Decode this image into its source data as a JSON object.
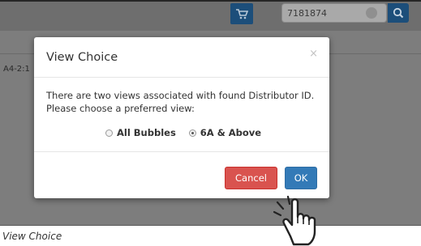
{
  "search": {
    "value": "7181874"
  },
  "side_label": "A4-2:1",
  "modal": {
    "title": "View Choice",
    "close_label": "×",
    "message_line1": "There are two views associated with found Distributor ID.",
    "message_line2": "Please choose a preferred view:",
    "options": [
      {
        "label": "All Bubbles",
        "selected": false
      },
      {
        "label": "6A & Above",
        "selected": true
      }
    ],
    "cancel_label": "Cancel",
    "ok_label": "OK"
  },
  "caption": "View Choice",
  "colors": {
    "primary": "#337ab7",
    "danger": "#d9534f",
    "overlay": "#7d7d7d"
  },
  "icons": [
    "cart-icon",
    "clear-icon",
    "search-icon",
    "close-icon",
    "pointer-hand-icon"
  ]
}
